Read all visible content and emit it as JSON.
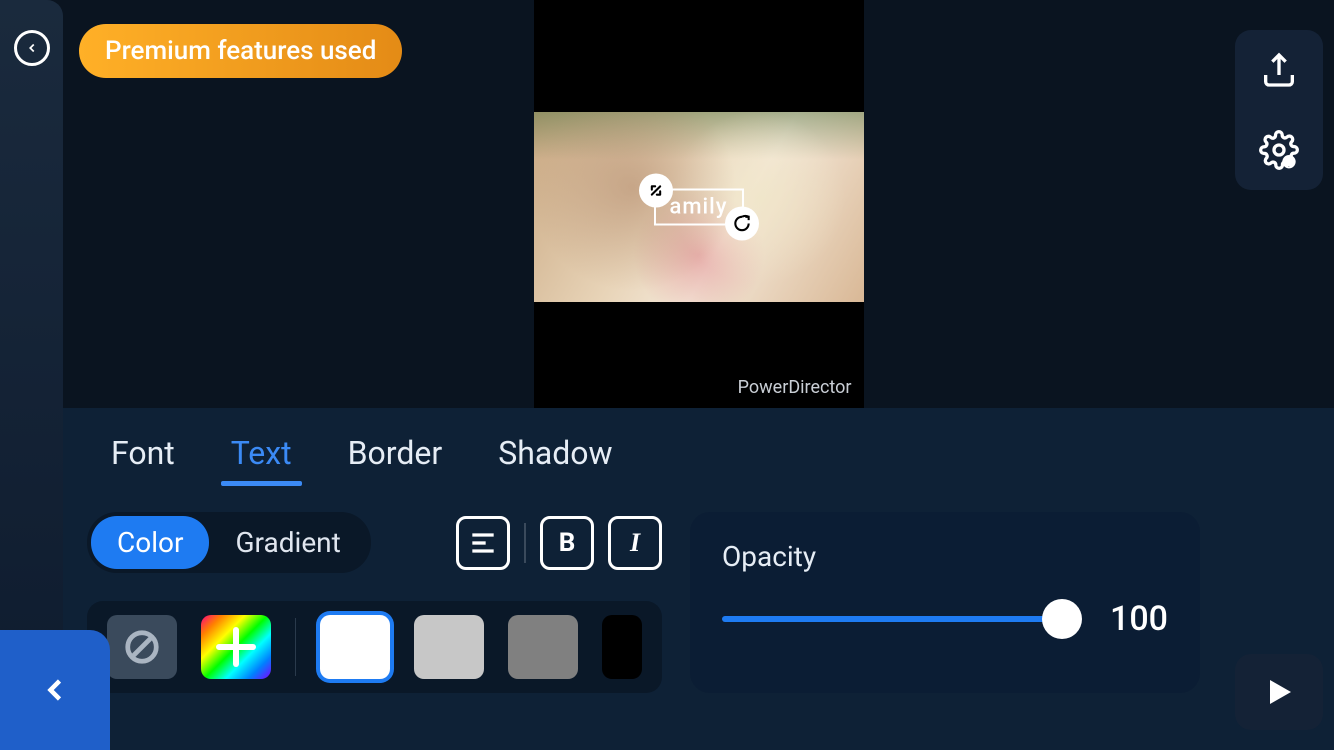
{
  "premium_badge": "Premium features used",
  "overlay_text": "amily",
  "watermark": "PowerDirector",
  "tabs": {
    "font": "Font",
    "text": "Text",
    "border": "Border",
    "shadow": "Shadow"
  },
  "fill": {
    "color": "Color",
    "gradient": "Gradient"
  },
  "format": {
    "bold": "B",
    "italic": "I"
  },
  "opacity": {
    "label": "Opacity",
    "value": "100"
  },
  "swatches": {
    "white": "#ffffff",
    "lightgray": "#c7c7c7",
    "gray": "#808080",
    "black": "#000000"
  }
}
